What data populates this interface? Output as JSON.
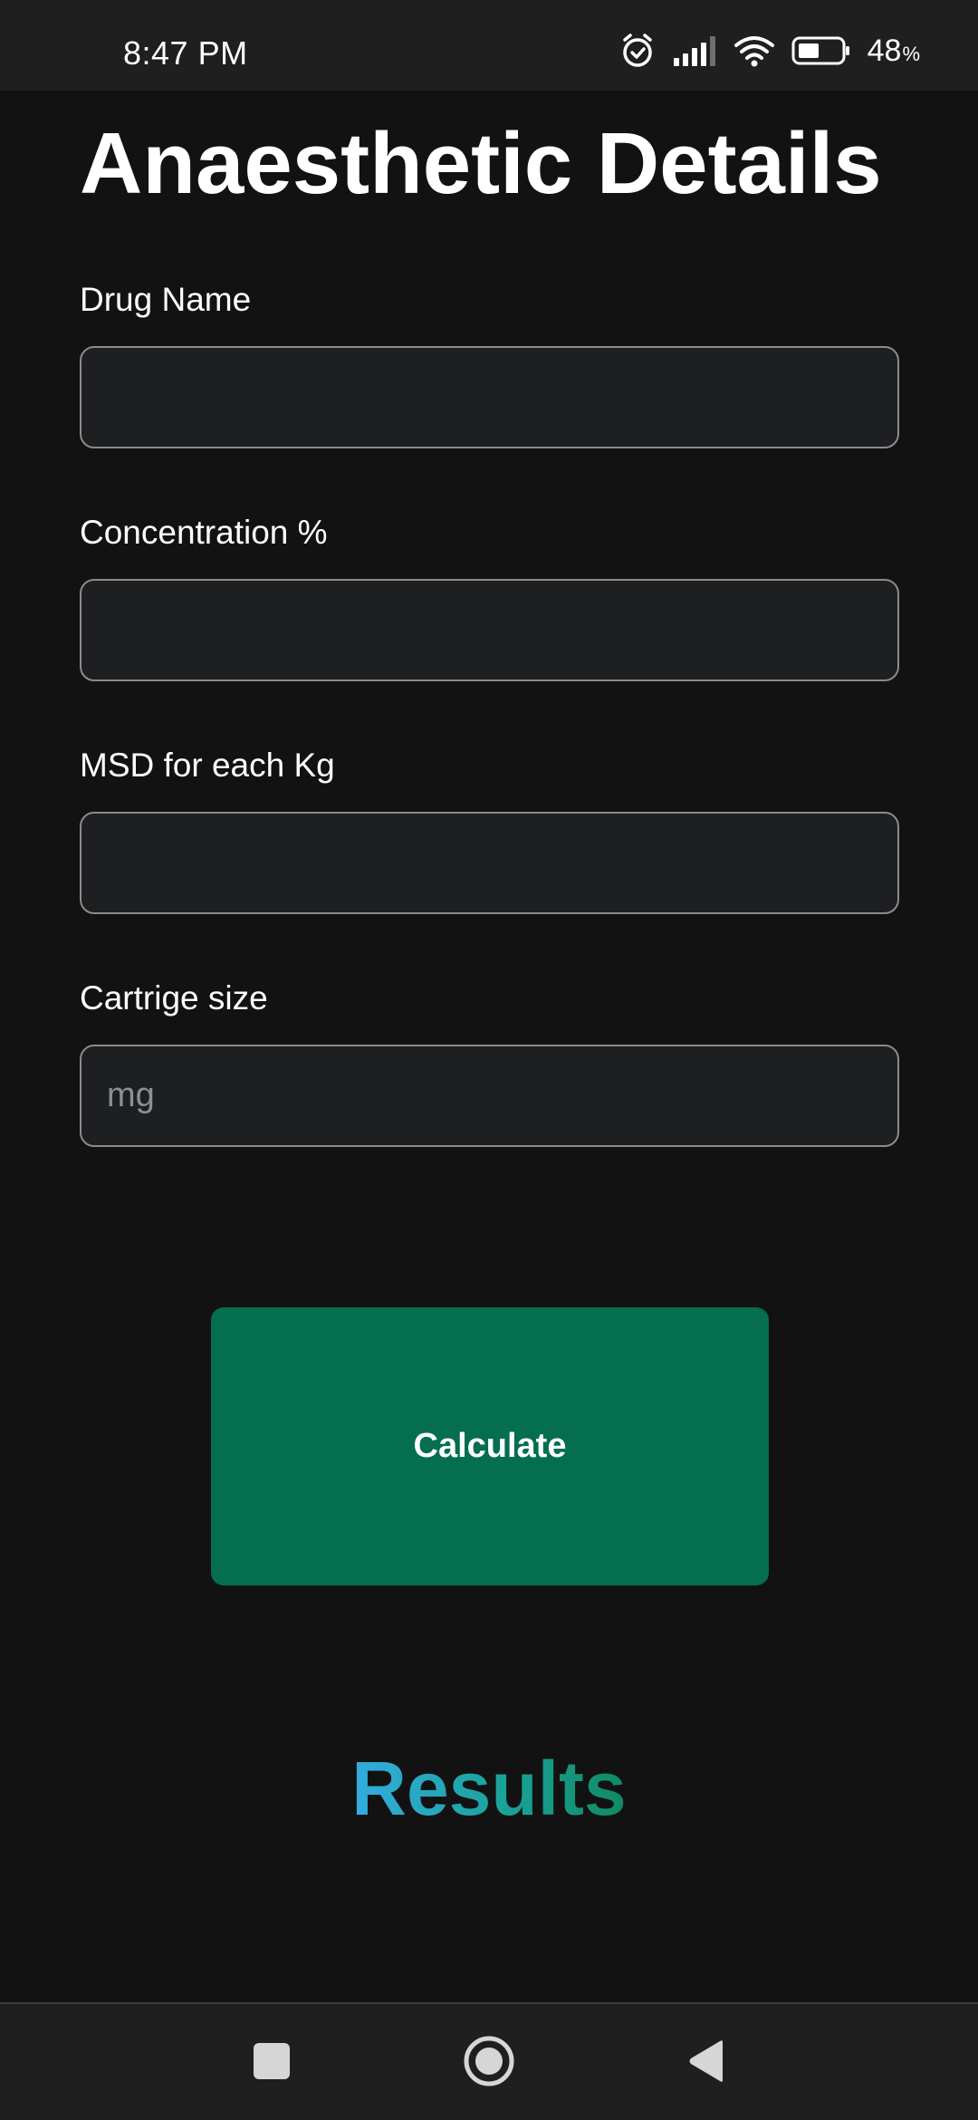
{
  "status_bar": {
    "time": "8:47 PM",
    "battery_percent": "48",
    "battery_sign": "%",
    "icons": [
      "alarm-icon",
      "signal-icon",
      "wifi-icon",
      "battery-icon"
    ]
  },
  "page": {
    "title": "Anaesthetic Details"
  },
  "form": {
    "fields": [
      {
        "label": "Drug Name",
        "value": "",
        "placeholder": ""
      },
      {
        "label": "Concentration %",
        "value": "",
        "placeholder": ""
      },
      {
        "label": "MSD for each Kg",
        "value": "",
        "placeholder": ""
      },
      {
        "label": "Cartrige size",
        "value": "",
        "placeholder": "mg"
      }
    ],
    "calculate_label": "Calculate"
  },
  "results": {
    "heading": "Results"
  },
  "nav_bar": {
    "icons": [
      "recents-icon",
      "home-icon",
      "back-icon"
    ]
  },
  "colors": {
    "background": "#121212",
    "input_background": "#1e1f21",
    "input_border": "#8b8b8e",
    "button": "#046e4f",
    "results_gradient_start": "#34ace0",
    "results_gradient_end": "#108a62"
  }
}
